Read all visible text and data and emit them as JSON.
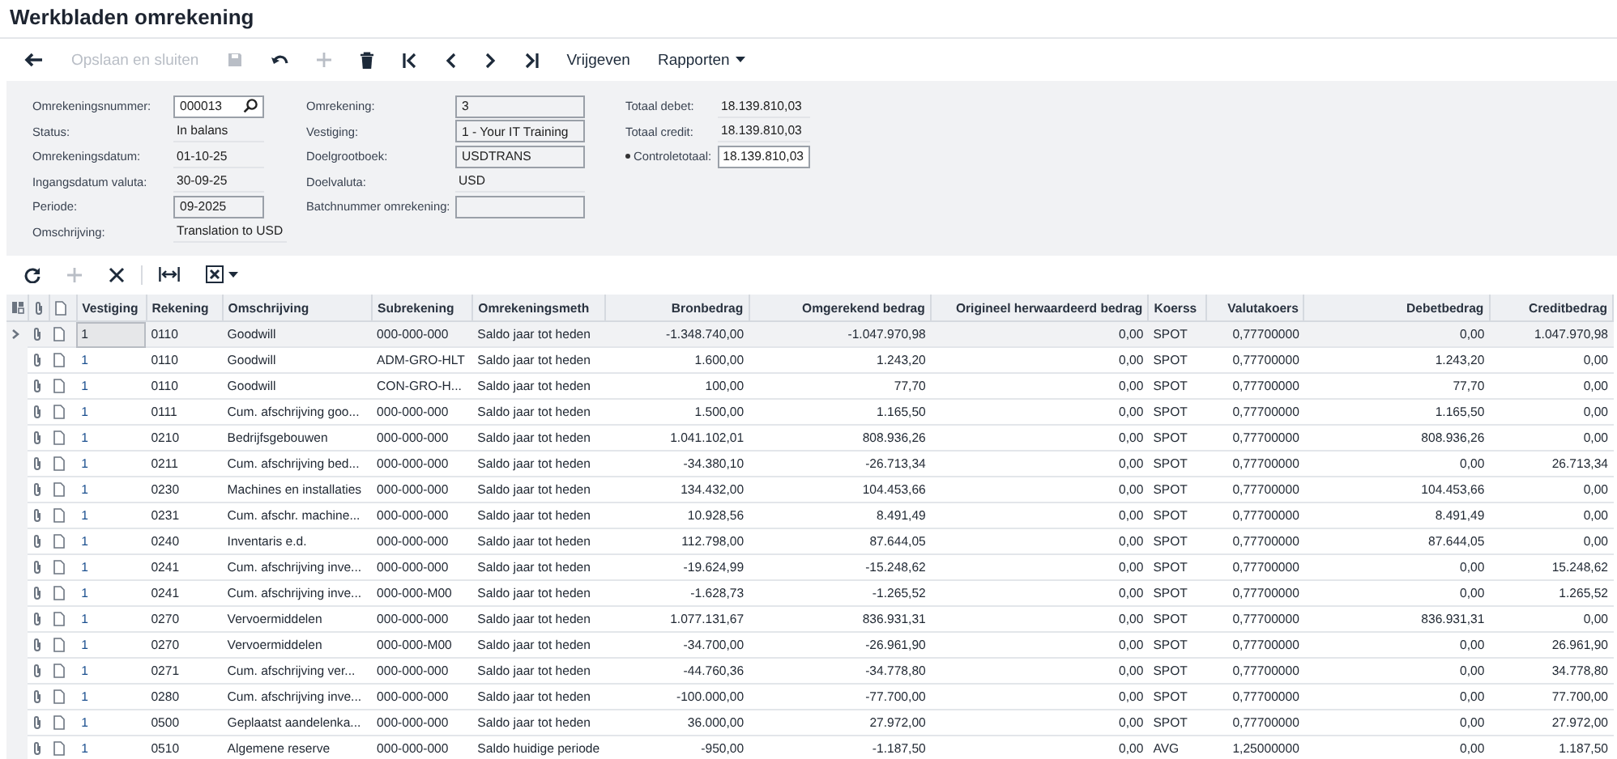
{
  "window": {
    "title": "Werkbladen omrekening"
  },
  "toolbar": [
    {
      "disabled": false
    },
    {
      "label": "Opslaan en sluiten",
      "disabled": true
    },
    {
      "disabled": true
    },
    {
      "disabled": false
    },
    {
      "disabled": true
    },
    {
      "disabled": false
    },
    {
      "disabled": false
    },
    {
      "disabled": false
    },
    {
      "disabled": false
    },
    {
      "disabled": false
    },
    {
      "label": "Vrijgeven",
      "disabled": false
    },
    {
      "label": "Rapporten",
      "disabled": false,
      "menu": true
    }
  ],
  "form": {
    "columns": [
      [
        {
          "label": "Omrekeningsnummer:",
          "value": "000013",
          "kind": "lookup"
        },
        {
          "label": "Status:",
          "value": "In balans",
          "kind": "text"
        },
        {
          "label": "Omrekeningsdatum:",
          "value": "01-10-25",
          "kind": "text"
        },
        {
          "label": "Ingangsdatum valuta:",
          "value": "30-09-25",
          "kind": "text"
        },
        {
          "label": "Periode:",
          "value": "09-2025",
          "kind": "box"
        },
        {
          "label": "Omschrijving:",
          "value": "Translation to USD",
          "kind": "text"
        }
      ],
      [
        {
          "label": "Omrekening:",
          "value": "3",
          "kind": "box"
        },
        {
          "label": "Vestiging:",
          "value": "1 - Your IT Training",
          "kind": "box"
        },
        {
          "label": "Doelgrootboek:",
          "value": "USDTRANS",
          "kind": "box"
        },
        {
          "label": "Doelvaluta:",
          "value": "USD",
          "kind": "text"
        },
        {
          "label": "Batchnummer omrekening:",
          "kind": "box"
        }
      ],
      [
        {
          "label": "Totaal debet:",
          "value": "18.139.810,03",
          "kind": "text"
        },
        {
          "label": "Totaal credit:",
          "value": "18.139.810,03",
          "kind": "text"
        },
        {
          "label": "Controletotaal:",
          "value": "18.139.810,03",
          "kind": "input",
          "required": true
        }
      ]
    ]
  },
  "grid_toolbar": [
    {
      "disabled": false
    },
    {
      "disabled": true
    },
    {
      "disabled": false
    },
    {
      "disabled": false
    },
    {
      "disabled": false
    }
  ],
  "table": {
    "columns": [
      "Vestiging",
      "Rekening",
      "Omschrijving",
      "Subrekening",
      "Omrekeningsmeth",
      "Bronbedrag",
      "Omgerekend bedrag",
      "Origineel herwaardeerd bedrag",
      "Koerss",
      "Valutakoers",
      "Debetbedrag",
      "Creditbedrag"
    ],
    "rows": [
      {
        "selected": true,
        "cells": [
          "1",
          "0110",
          "Goodwill",
          "000-000-000",
          "Saldo jaar tot heden",
          "-1.348.740,00",
          "-1.047.970,98",
          "0,00",
          "SPOT",
          "0,77700000",
          "0,00",
          "1.047.970,98"
        ]
      },
      {
        "selected": false,
        "cells": [
          "1",
          "0110",
          "Goodwill",
          "ADM-GRO-HLT",
          "Saldo jaar tot heden",
          "1.600,00",
          "1.243,20",
          "0,00",
          "SPOT",
          "0,77700000",
          "1.243,20",
          "0,00"
        ]
      },
      {
        "selected": false,
        "cells": [
          "1",
          "0110",
          "Goodwill",
          "CON-GRO-H...",
          "Saldo jaar tot heden",
          "100,00",
          "77,70",
          "0,00",
          "SPOT",
          "0,77700000",
          "77,70",
          "0,00"
        ]
      },
      {
        "selected": false,
        "cells": [
          "1",
          "0111",
          "Cum. afschrijving goo...",
          "000-000-000",
          "Saldo jaar tot heden",
          "1.500,00",
          "1.165,50",
          "0,00",
          "SPOT",
          "0,77700000",
          "1.165,50",
          "0,00"
        ]
      },
      {
        "selected": false,
        "cells": [
          "1",
          "0210",
          "Bedrijfsgebouwen",
          "000-000-000",
          "Saldo jaar tot heden",
          "1.041.102,01",
          "808.936,26",
          "0,00",
          "SPOT",
          "0,77700000",
          "808.936,26",
          "0,00"
        ]
      },
      {
        "selected": false,
        "cells": [
          "1",
          "0211",
          "Cum. afschrijving bed...",
          "000-000-000",
          "Saldo jaar tot heden",
          "-34.380,10",
          "-26.713,34",
          "0,00",
          "SPOT",
          "0,77700000",
          "0,00",
          "26.713,34"
        ]
      },
      {
        "selected": false,
        "cells": [
          "1",
          "0230",
          "Machines en installaties",
          "000-000-000",
          "Saldo jaar tot heden",
          "134.432,00",
          "104.453,66",
          "0,00",
          "SPOT",
          "0,77700000",
          "104.453,66",
          "0,00"
        ]
      },
      {
        "selected": false,
        "cells": [
          "1",
          "0231",
          "Cum. afschr. machine...",
          "000-000-000",
          "Saldo jaar tot heden",
          "10.928,56",
          "8.491,49",
          "0,00",
          "SPOT",
          "0,77700000",
          "8.491,49",
          "0,00"
        ]
      },
      {
        "selected": false,
        "cells": [
          "1",
          "0240",
          "Inventaris e.d.",
          "000-000-000",
          "Saldo jaar tot heden",
          "112.798,00",
          "87.644,05",
          "0,00",
          "SPOT",
          "0,77700000",
          "87.644,05",
          "0,00"
        ]
      },
      {
        "selected": false,
        "cells": [
          "1",
          "0241",
          "Cum. afschrijving inve...",
          "000-000-000",
          "Saldo jaar tot heden",
          "-19.624,99",
          "-15.248,62",
          "0,00",
          "SPOT",
          "0,77700000",
          "0,00",
          "15.248,62"
        ]
      },
      {
        "selected": false,
        "cells": [
          "1",
          "0241",
          "Cum. afschrijving inve...",
          "000-000-M00",
          "Saldo jaar tot heden",
          "-1.628,73",
          "-1.265,52",
          "0,00",
          "SPOT",
          "0,77700000",
          "0,00",
          "1.265,52"
        ]
      },
      {
        "selected": false,
        "cells": [
          "1",
          "0270",
          "Vervoermiddelen",
          "000-000-000",
          "Saldo jaar tot heden",
          "1.077.131,67",
          "836.931,31",
          "0,00",
          "SPOT",
          "0,77700000",
          "836.931,31",
          "0,00"
        ]
      },
      {
        "selected": false,
        "cells": [
          "1",
          "0270",
          "Vervoermiddelen",
          "000-000-M00",
          "Saldo jaar tot heden",
          "-34.700,00",
          "-26.961,90",
          "0,00",
          "SPOT",
          "0,77700000",
          "0,00",
          "26.961,90"
        ]
      },
      {
        "selected": false,
        "cells": [
          "1",
          "0271",
          "Cum. afschrijving ver...",
          "000-000-000",
          "Saldo jaar tot heden",
          "-44.760,36",
          "-34.778,80",
          "0,00",
          "SPOT",
          "0,77700000",
          "0,00",
          "34.778,80"
        ]
      },
      {
        "selected": false,
        "cells": [
          "1",
          "0280",
          "Cum. afschrijving inve...",
          "000-000-000",
          "Saldo jaar tot heden",
          "-100.000,00",
          "-77.700,00",
          "0,00",
          "SPOT",
          "0,77700000",
          "0,00",
          "77.700,00"
        ]
      },
      {
        "selected": false,
        "cells": [
          "1",
          "0500",
          "Geplaatst aandelenka...",
          "000-000-000",
          "Saldo jaar tot heden",
          "36.000,00",
          "27.972,00",
          "0,00",
          "SPOT",
          "0,77700000",
          "0,00",
          "27.972,00"
        ]
      },
      {
        "selected": false,
        "cells": [
          "1",
          "0510",
          "Algemene reserve",
          "000-000-000",
          "Saldo huidige periode",
          "-950,00",
          "-1.187,50",
          "0,00",
          "AVG",
          "1,25000000",
          "0,00",
          "1.187,50"
        ]
      }
    ]
  }
}
